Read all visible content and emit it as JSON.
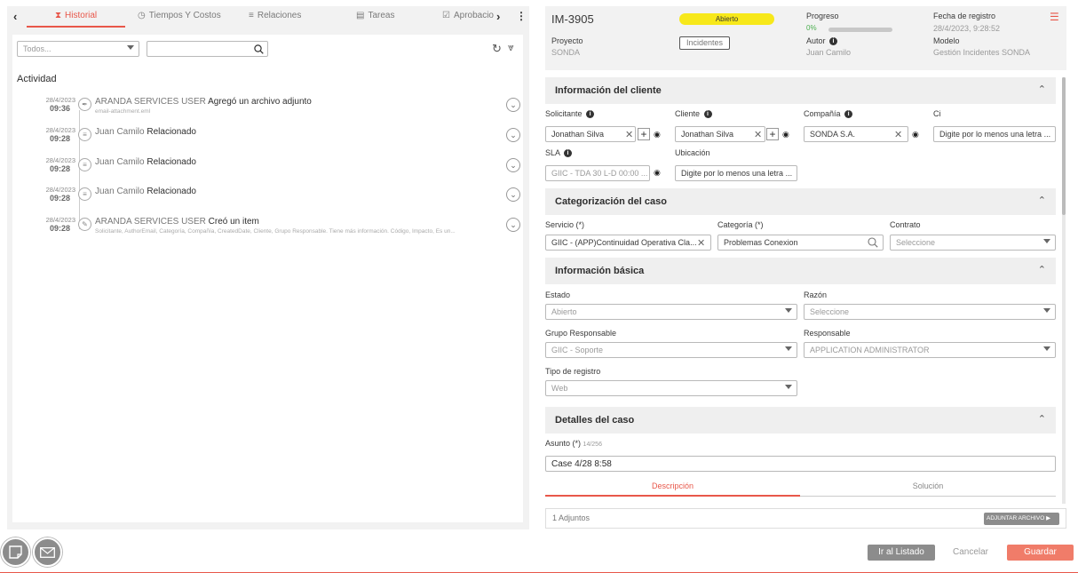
{
  "left_panel": {
    "tabs": [
      {
        "label": "Historial",
        "icon": "hourglass-icon",
        "active": true
      },
      {
        "label": "Tiempos Y Costos",
        "icon": "clock-money-icon",
        "active": false
      },
      {
        "label": "Relaciones",
        "icon": "list-icon",
        "active": false
      },
      {
        "label": "Tareas",
        "icon": "task-icon",
        "active": false
      },
      {
        "label": "Aprobacio",
        "icon": "check-icon",
        "active": false
      }
    ],
    "filter": {
      "value": "Todos...",
      "search_placeholder": ""
    },
    "activity_title": "Actividad",
    "timeline": [
      {
        "date": "28/4/2023",
        "time": "09:36",
        "icon": "paperclip-icon",
        "user": "ARANDA SERVICES USER",
        "action": "Agregó un archivo adjunto",
        "sub": "email-attachment.eml"
      },
      {
        "date": "28/4/2023",
        "time": "09:28",
        "icon": "document-icon",
        "user": "Juan Camilo",
        "action": "Relacionado",
        "sub": ""
      },
      {
        "date": "28/4/2023",
        "time": "09:28",
        "icon": "document-icon",
        "user": "Juan Camilo",
        "action": "Relacionado",
        "sub": ""
      },
      {
        "date": "28/4/2023",
        "time": "09:28",
        "icon": "document-icon",
        "user": "Juan Camilo",
        "action": "Relacionado",
        "sub": ""
      },
      {
        "date": "28/4/2023",
        "time": "09:28",
        "icon": "pencil-icon",
        "user": "ARANDA SERVICES USER",
        "action": "Creó un item",
        "sub": "Solicitante, AuthorEmail, Categoría, Compañía, CreatedDate, Cliente, Grupo Responsable. Tiene más información. Código, Impacto, Es un..."
      }
    ]
  },
  "header": {
    "case_id": "IM-3905",
    "status": "Abierto",
    "progress_label": "Progreso",
    "progress_value": "0%",
    "progress_fraction": 0.0,
    "registro_label": "Fecha de registro",
    "registro_value": "28/4/2023, 9:28:52",
    "proyecto_label": "Proyecto",
    "proyecto_value": "SONDA",
    "incidentes_button": "Incidentes",
    "autor_label": "Autor",
    "autor_value": "Juan Camilo",
    "modelo_label": "Modelo",
    "modelo_value": "Gestión Incidentes SONDA"
  },
  "sections": {
    "cliente": {
      "title": "Información del cliente",
      "solicitante_label": "Solicitante",
      "solicitante_value": "Jonathan Silva",
      "cliente_label": "Cliente",
      "cliente_value": "Jonathan Silva",
      "compania_label": "Compañía",
      "compania_value": "SONDA S.A.",
      "ci_label": "Ci",
      "ci_placeholder": "Digite por lo menos una letra ...",
      "sla_label": "SLA",
      "sla_value": "GIIC - TDA 30 L-D 00:00 ...",
      "ubicacion_label": "Ubicación",
      "ubicacion_placeholder": "Digite por lo menos una letra ..."
    },
    "categorizacion": {
      "title": "Categorización del caso",
      "servicio_label": "Servicio (*)",
      "servicio_value": "GIIC - (APP)Continuidad Operativa Cla...",
      "categoria_label": "Categoría (*)",
      "categoria_value": "Problemas Conexion",
      "contrato_label": "Contrato",
      "contrato_value": "Seleccione"
    },
    "basica": {
      "title": "Información básica",
      "estado_label": "Estado",
      "estado_value": "Abierto",
      "razon_label": "Razón",
      "razon_value": "Seleccione",
      "grupo_label": "Grupo Responsable",
      "grupo_value": "GIIC - Soporte",
      "responsable_label": "Responsable",
      "responsable_value": "APPLICATION ADMINISTRATOR",
      "tipo_label": "Tipo de registro",
      "tipo_value": "Web"
    },
    "detalles": {
      "title": "Detalles del caso",
      "asunto_label": "Asunto (*)",
      "asunto_count": "14/256",
      "asunto_value": "Case 4/28 8:58",
      "tab_descripcion": "Descripción",
      "tab_solucion": "Solución"
    }
  },
  "attachments": {
    "count_label": "1 Adjuntos",
    "button_label": "ADJUNTAR ARCHIVO"
  },
  "footer": {
    "list_button": "Ir al Listado",
    "cancel_button": "Cancelar",
    "save_button": "Guardar"
  },
  "colors": {
    "accent": "#e8574a",
    "status_open": "#f7e81a",
    "dark_button": "#8c8c8c",
    "save_button": "#f07c69"
  }
}
